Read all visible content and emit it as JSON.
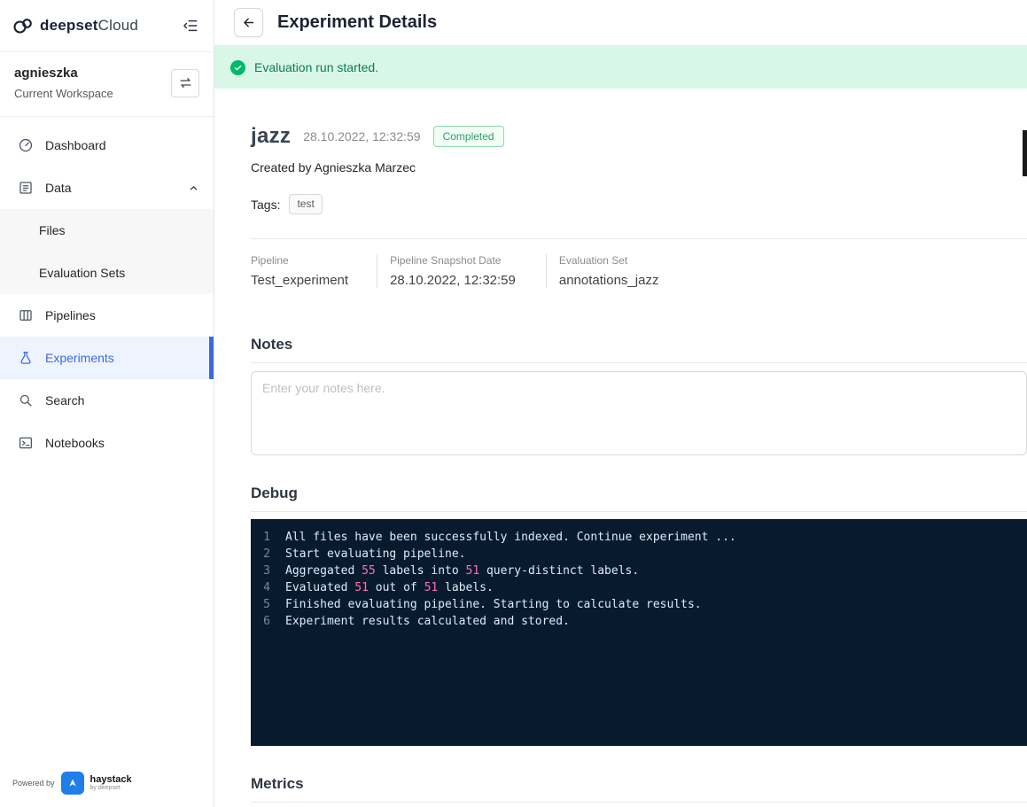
{
  "colors": {
    "accent_blue": "#3e6ae1",
    "active_nav_bg": "#eef4fd",
    "banner_bg": "#d9f7e8",
    "banner_text": "#0d7a55",
    "success_green": "#00b96b",
    "badge_text_green": "#2f9e68",
    "badge_border_green": "#8ad9ae",
    "code_bg": "#081b2e",
    "code_text": "#dcebf8",
    "code_highlight_pink": "#ff6fae",
    "haystack_blue": "#1f7fe8"
  },
  "sidebar": {
    "logo": {
      "bold": "deepset",
      "light": "Cloud",
      "icon": "deepset-cloud-logo-icon"
    },
    "collapse_icon": "menu-fold-icon",
    "workspace": {
      "name": "agnieszka",
      "label": "Current Workspace",
      "switch_icon": "swap-icon"
    },
    "nav": [
      {
        "label": "Dashboard",
        "icon": "dashboard-icon"
      },
      {
        "label": "Data",
        "icon": "data-icon",
        "expanded": true
      },
      {
        "label": "Files",
        "child": true
      },
      {
        "label": "Evaluation Sets",
        "child": true
      },
      {
        "label": "Pipelines",
        "icon": "pipelines-icon"
      },
      {
        "label": "Experiments",
        "icon": "experiments-flask-icon",
        "active": true
      },
      {
        "label": "Search",
        "icon": "search-icon"
      },
      {
        "label": "Notebooks",
        "icon": "notebooks-icon"
      }
    ],
    "footer": {
      "powered_by": "Powered by",
      "brand": "haystack",
      "sub": "by deepset"
    }
  },
  "header": {
    "title": "Experiment Details",
    "back_icon": "arrow-left-icon"
  },
  "banner": {
    "text": "Evaluation run started.",
    "icon": "check-circle-icon"
  },
  "experiment": {
    "name": "jazz",
    "timestamp": "28.10.2022, 12:32:59",
    "status": "Completed",
    "created_by": "Created by Agnieszka Marzec",
    "tags_label": "Tags:",
    "tags": [
      "test"
    ],
    "info": [
      {
        "label": "Pipeline",
        "value": "Test_experiment"
      },
      {
        "label": "Pipeline Snapshot Date",
        "value": "28.10.2022, 12:32:59"
      },
      {
        "label": "Evaluation Set",
        "value": "annotations_jazz"
      }
    ]
  },
  "notes": {
    "heading": "Notes",
    "placeholder": "Enter your notes here.",
    "value": ""
  },
  "debug": {
    "heading": "Debug",
    "lines": [
      {
        "num": "1",
        "segments": [
          {
            "text": "All files have been successfully indexed. Continue experiment ...",
            "hl": false
          }
        ]
      },
      {
        "num": "2",
        "segments": [
          {
            "text": "Start evaluating pipeline.",
            "hl": false
          }
        ]
      },
      {
        "num": "3",
        "segments": [
          {
            "text": "Aggregated ",
            "hl": false
          },
          {
            "text": "55",
            "hl": true
          },
          {
            "text": " labels into ",
            "hl": false
          },
          {
            "text": "51",
            "hl": true
          },
          {
            "text": " query-distinct labels.",
            "hl": false
          }
        ]
      },
      {
        "num": "4",
        "segments": [
          {
            "text": "Evaluated ",
            "hl": false
          },
          {
            "text": "51",
            "hl": true
          },
          {
            "text": " out of ",
            "hl": false
          },
          {
            "text": "51",
            "hl": true
          },
          {
            "text": " labels.",
            "hl": false
          }
        ]
      },
      {
        "num": "5",
        "segments": [
          {
            "text": "Finished evaluating pipeline. Starting to calculate results.",
            "hl": false
          }
        ]
      },
      {
        "num": "6",
        "segments": [
          {
            "text": "Experiment results calculated and stored.",
            "hl": false
          }
        ]
      }
    ]
  },
  "metrics": {
    "heading": "Metrics"
  }
}
